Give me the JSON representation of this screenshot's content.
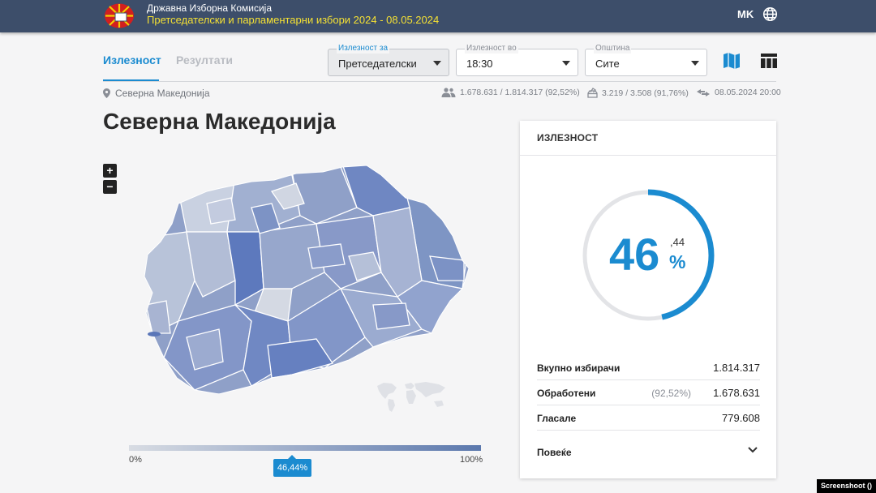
{
  "header": {
    "org_name": "Државна Изборна Комисија",
    "election_name": "Претседателски и парламентарни избори 2024 - 08.05.2024",
    "language": "MK"
  },
  "tabs": {
    "turnout": "Излезност",
    "results": "Резултати"
  },
  "filters": {
    "turnout_for": {
      "label": "Излезност за",
      "value": "Претседателски"
    },
    "turnout_at": {
      "label": "Излезност во",
      "value": "18:30"
    },
    "municipality": {
      "label": "Општина",
      "value": "Сите"
    }
  },
  "breadcrumb": "Северна Македонија",
  "stats": {
    "voters": "1.678.631 / 1.814.317 (92,52%)",
    "polling_stations": "3.219 / 3.508 (91,76%)",
    "updated": "08.05.2024 20:00"
  },
  "page_title": "Северна Македонија",
  "map": {
    "zoom_in": "+",
    "zoom_out": "−",
    "legend_min": "0%",
    "legend_max": "100%",
    "legend_value": "46,44%",
    "legend_fraction": 0.4644
  },
  "card": {
    "title": "ИЗЛЕЗНОСТ",
    "percent_int": "46",
    "percent_dec": ",44",
    "percent_sign": "%",
    "turnout_fraction": 0.4644,
    "rows": {
      "total_voters": {
        "label": "Вкупно избирачи",
        "value": "1.814.317"
      },
      "processed": {
        "label": "Обработени",
        "pct": "(92,52%)",
        "value": "1.678.631"
      },
      "voted": {
        "label": "Гласале",
        "value": "779.608"
      }
    },
    "more": "Повеќе"
  },
  "colors": {
    "accent": "#1b8bd0",
    "header_bg": "#3d4e6a",
    "header_yellow": "#f5e133"
  },
  "watermark": "Screenshoot ()"
}
